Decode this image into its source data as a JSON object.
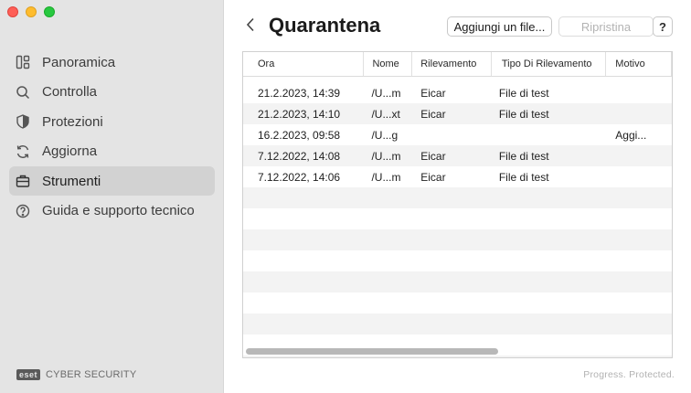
{
  "sidebar": {
    "items": [
      {
        "label": "Panoramica",
        "icon": "dashboard-icon"
      },
      {
        "label": "Controlla",
        "icon": "search-icon"
      },
      {
        "label": "Protezioni",
        "icon": "shield-icon"
      },
      {
        "label": "Aggiorna",
        "icon": "refresh-icon"
      },
      {
        "label": "Strumenti",
        "icon": "briefcase-icon",
        "active": true
      },
      {
        "label": "Guida e supporto tecnico",
        "icon": "help-icon"
      }
    ],
    "brand_logo": "eset",
    "brand_text": "CYBER SECURITY"
  },
  "header": {
    "title": "Quarantena",
    "add_label": "Aggiungi un file...",
    "restore_label": "Ripristina",
    "help_label": "?"
  },
  "table": {
    "columns": [
      "Ora",
      "Nome",
      "Rilevamento",
      "Tipo Di Rilevamento",
      "Motivo"
    ],
    "rows": [
      [
        "21.2.2023, 14:39",
        "/U...m",
        "Eicar",
        "File di test",
        ""
      ],
      [
        "21.2.2023, 14:10",
        "/U...xt",
        "Eicar",
        "File di test",
        ""
      ],
      [
        "16.2.2023, 09:58",
        "/U...g",
        "",
        "",
        "Aggi..."
      ],
      [
        "7.12.2022, 14:08",
        "/U...m",
        "Eicar",
        "File di test",
        ""
      ],
      [
        "7.12.2022, 14:06",
        "/U...m",
        "Eicar",
        "File di test",
        ""
      ]
    ]
  },
  "footer": {
    "tagline": "Progress. Protected."
  },
  "colors": {
    "sidebar_bg": "#e4e4e4",
    "active_item_bg": "#d2d2d2",
    "alt_row_bg": "#f3f3f3"
  }
}
